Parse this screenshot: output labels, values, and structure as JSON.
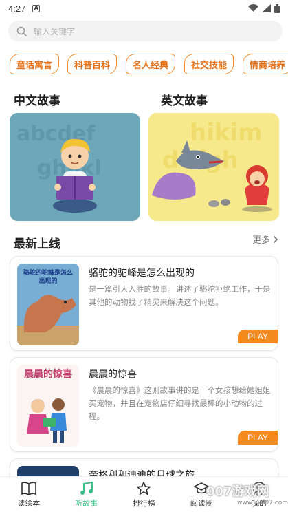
{
  "status_bar": {
    "time": "4:27",
    "notif_letter": "A"
  },
  "search": {
    "placeholder": "输入关键字"
  },
  "categories": [
    "童话寓言",
    "科普百科",
    "名人经典",
    "社交技能",
    "情商培养"
  ],
  "sections": {
    "chinese_stories": "中文故事",
    "english_stories": "英文故事",
    "new_releases": "最新上线",
    "more": "更多"
  },
  "books": [
    {
      "title": "骆驼的驼峰是怎么出现的",
      "description": "是一篇引人入胜的故事。讲述了骆驼拒绝工作，于是其他的动物找了精灵来解决这个问题。",
      "cover_text": "骆驼的驼峰是怎么出现的",
      "play": "PLAY"
    },
    {
      "title": "晨晨的惊喜",
      "description": "《晨晨的惊喜》这则故事讲的是一个女孩想给她姐姐买宠物，并且在宠物店仔细寻找最棒的小动物的过程。",
      "cover_text": "晨晨的惊喜",
      "play": "PLAY"
    },
    {
      "title": "奎格利和迪迪的月球之旅"
    }
  ],
  "bottom_nav": [
    {
      "label": "读绘本",
      "icon": "book-icon"
    },
    {
      "label": "听故事",
      "icon": "music-note-icon",
      "active": true
    },
    {
      "label": "排行榜",
      "icon": "star-icon"
    },
    {
      "label": "阅读圈",
      "icon": "graduation-cap-icon"
    },
    {
      "label": "我的",
      "icon": "user-icon"
    }
  ],
  "watermark": {
    "text": "007游戏网",
    "url": "www.yx007.com"
  },
  "colors": {
    "accent_orange": "#f08a2b",
    "active_green": "#3dbf8a",
    "play_orange": "#f58a20"
  }
}
